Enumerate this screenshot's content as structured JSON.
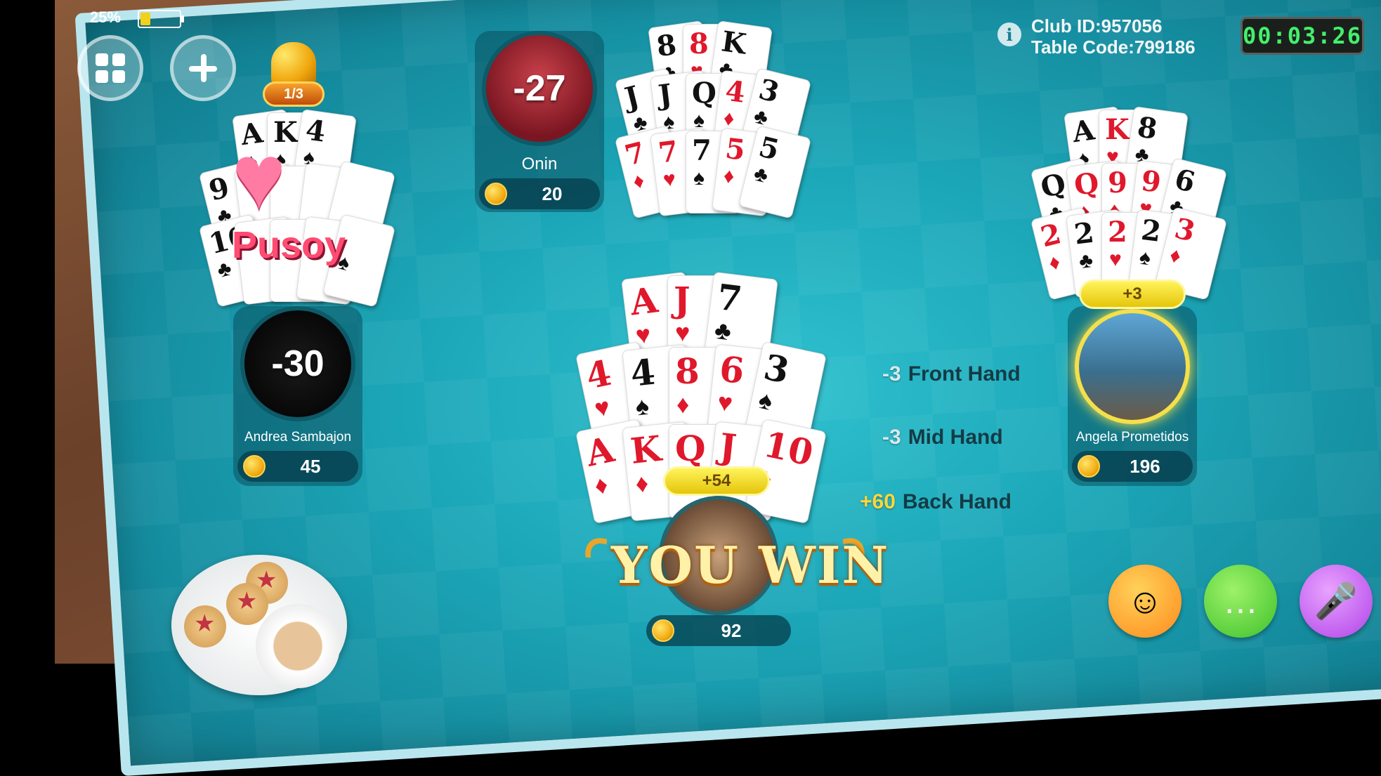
{
  "status": {
    "battery_percent": "25%",
    "battery_level": 0.25
  },
  "top_left": {
    "gift_counter": "1/3"
  },
  "club": {
    "club_id": "Club ID:957056",
    "table_code": "Table Code:799186"
  },
  "timer": "00:03:26",
  "players": {
    "top": {
      "name": "Onin",
      "score": "-27",
      "coins": "20"
    },
    "left": {
      "name": "Andrea Sambajon",
      "score": "-30",
      "coins": "45",
      "badge": "Pusoy"
    },
    "right": {
      "name": "Angela Prometidos",
      "score": "+3",
      "coins": "196"
    },
    "self": {
      "score": "+54",
      "coins": "92",
      "result": "YOU WIN"
    }
  },
  "hand_results": [
    {
      "points": "-3",
      "label": "Front Hand"
    },
    {
      "points": "-3",
      "label": "Mid Hand"
    },
    {
      "points": "+60",
      "label": "Back Hand"
    }
  ],
  "cards": {
    "top": {
      "front": [
        [
          "8",
          "♣"
        ],
        [
          "8",
          "♥"
        ],
        [
          "K",
          "♣"
        ]
      ],
      "mid": [
        [
          "J",
          "♣"
        ],
        [
          "J",
          "♠"
        ],
        [
          "Q",
          "♠"
        ],
        [
          "4",
          "♦"
        ],
        [
          "3",
          "♣"
        ]
      ],
      "back": [
        [
          "7",
          "♦"
        ],
        [
          "7",
          "♥"
        ],
        [
          "7",
          "♠"
        ],
        [
          "5",
          "♦"
        ],
        [
          "5",
          "♣"
        ]
      ]
    },
    "left": {
      "front": [
        [
          "A",
          "♠"
        ],
        [
          "K",
          "♠"
        ],
        [
          "4",
          "♠"
        ]
      ],
      "mid": [
        [
          "9",
          "♣"
        ],
        [
          "",
          ""
        ],
        [
          "",
          ""
        ],
        [
          "",
          ""
        ],
        [
          "",
          ""
        ]
      ],
      "back": [
        [
          "10",
          "♣"
        ],
        [
          "",
          ""
        ],
        [
          "",
          ""
        ],
        [
          "",
          ""
        ],
        [
          "",
          "♠"
        ]
      ]
    },
    "right": {
      "front": [
        [
          "A",
          "♠"
        ],
        [
          "K",
          "♥"
        ],
        [
          "8",
          "♣"
        ]
      ],
      "mid": [
        [
          "Q",
          "♣"
        ],
        [
          "Q",
          "♦"
        ],
        [
          "9",
          "♦"
        ],
        [
          "9",
          "♥"
        ],
        [
          "6",
          "♣"
        ]
      ],
      "back": [
        [
          "2",
          "♦"
        ],
        [
          "2",
          "♣"
        ],
        [
          "2",
          "♥"
        ],
        [
          "2",
          "♠"
        ],
        [
          "3",
          "♦"
        ]
      ]
    },
    "self": {
      "front": [
        [
          "A",
          "♥"
        ],
        [
          "J",
          "♥"
        ],
        [
          "7",
          "♣"
        ]
      ],
      "mid": [
        [
          "4",
          "♥"
        ],
        [
          "4",
          "♠"
        ],
        [
          "8",
          "♦"
        ],
        [
          "6",
          "♥"
        ],
        [
          "3",
          "♠"
        ]
      ],
      "back": [
        [
          "A",
          "♦"
        ],
        [
          "K",
          "♦"
        ],
        [
          "Q",
          "♦"
        ],
        [
          "J",
          "♦"
        ],
        [
          "10",
          "♦"
        ]
      ]
    }
  }
}
